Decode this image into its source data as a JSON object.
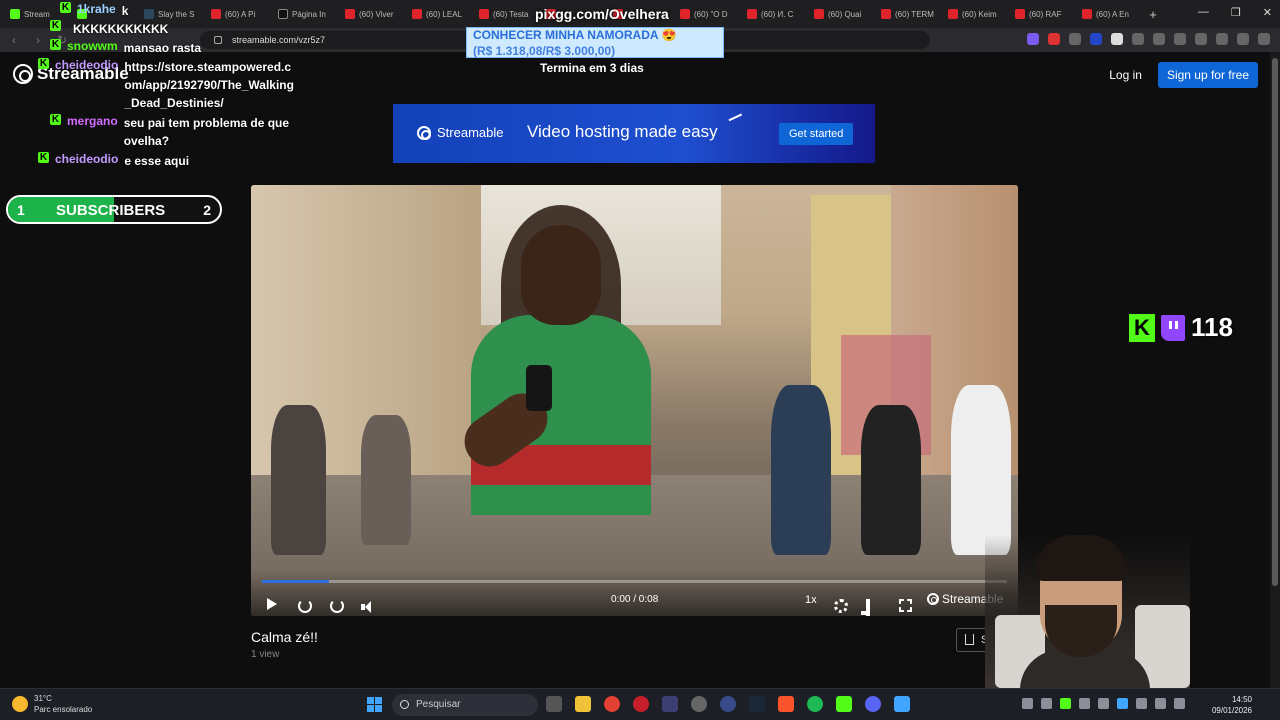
{
  "browser": {
    "tabs": [
      {
        "label": "Stream",
        "icon": "kick-icon"
      },
      {
        "label": "",
        "icon": "kick-icon"
      },
      {
        "label": "Slay the S",
        "icon": "steam-icon"
      },
      {
        "label": "(60) A Pi",
        "icon": "youtube-icon"
      },
      {
        "label": "Página In",
        "icon": "x-icon"
      },
      {
        "label": "(60) Viver",
        "icon": "youtube-icon"
      },
      {
        "label": "(60) LEAL",
        "icon": "youtube-icon"
      },
      {
        "label": "(60) Testa",
        "icon": "youtube-icon"
      },
      {
        "label": "",
        "icon": "youtube-icon"
      },
      {
        "label": "",
        "icon": "youtube-icon"
      },
      {
        "label": "(60) \"O D",
        "icon": "youtube-icon"
      },
      {
        "label": "(60) И. С",
        "icon": "youtube-icon"
      },
      {
        "label": "(60) Quai",
        "icon": "youtube-icon"
      },
      {
        "label": "(60) TERM",
        "icon": "youtube-icon"
      },
      {
        "label": "(60) Keim",
        "icon": "youtube-icon"
      },
      {
        "label": "(60) RAF",
        "icon": "youtube-icon"
      },
      {
        "label": "(60) A En",
        "icon": "youtube-icon"
      }
    ],
    "new_tab": "+",
    "url": "streamable.com/vzr5z7"
  },
  "site": {
    "logo": "Streamable",
    "login": "Log in",
    "signup": "Sign up for free",
    "banner": {
      "logo": "Streamable",
      "tagline": "Video hosting made easy",
      "cta": "Get started"
    },
    "player": {
      "time": "0:00 / 0:08",
      "speed": "1x",
      "brand": "Streamable",
      "progress_fraction": 0.09
    },
    "video_title": "Calma zé!!",
    "views": "1 view",
    "share": "Sha"
  },
  "overlay": {
    "pix_title": "pixgg.com/Ovelhera",
    "goal_line1": "CONHECER MINHA NAMORADA 😍",
    "goal_line2": "(R$ 1.318,08/R$ 3.000,00)",
    "goal_ends": "Termina em 3 dias",
    "subs": {
      "low": "1",
      "label": "SUBSCRIBERS",
      "high": "2",
      "fill_fraction": 0.5
    },
    "viewer_count": "118",
    "chat": [
      {
        "user": "1krahe",
        "color": "#9ad0ff",
        "msg": "k"
      },
      {
        "user": "",
        "color": "#e24a4a",
        "msg": "KKKKKKKKKKK"
      },
      {
        "user": "snowwm",
        "color": "#53fc18",
        "msg": "mansao rasta"
      },
      {
        "user": "cheideodio",
        "color": "#c39bff",
        "msg": "https://store.steampowered.com/app/2192790/The_Walking_Dead_Destinies/"
      },
      {
        "user": "mergano",
        "color": "#d46bff",
        "msg": "seu pai tem problema de que ovelha?"
      },
      {
        "user": "cheideodio",
        "color": "#c39bff",
        "msg": "e esse aqui"
      }
    ]
  },
  "taskbar": {
    "temp": "31°C",
    "weather": "Parc ensolarado",
    "search": "Pesquisar",
    "time": "14:50",
    "date": "09/01/2026"
  },
  "colors": {
    "accent": "#0f66d6",
    "kick": "#53fc18",
    "twitch": "#9146ff"
  }
}
